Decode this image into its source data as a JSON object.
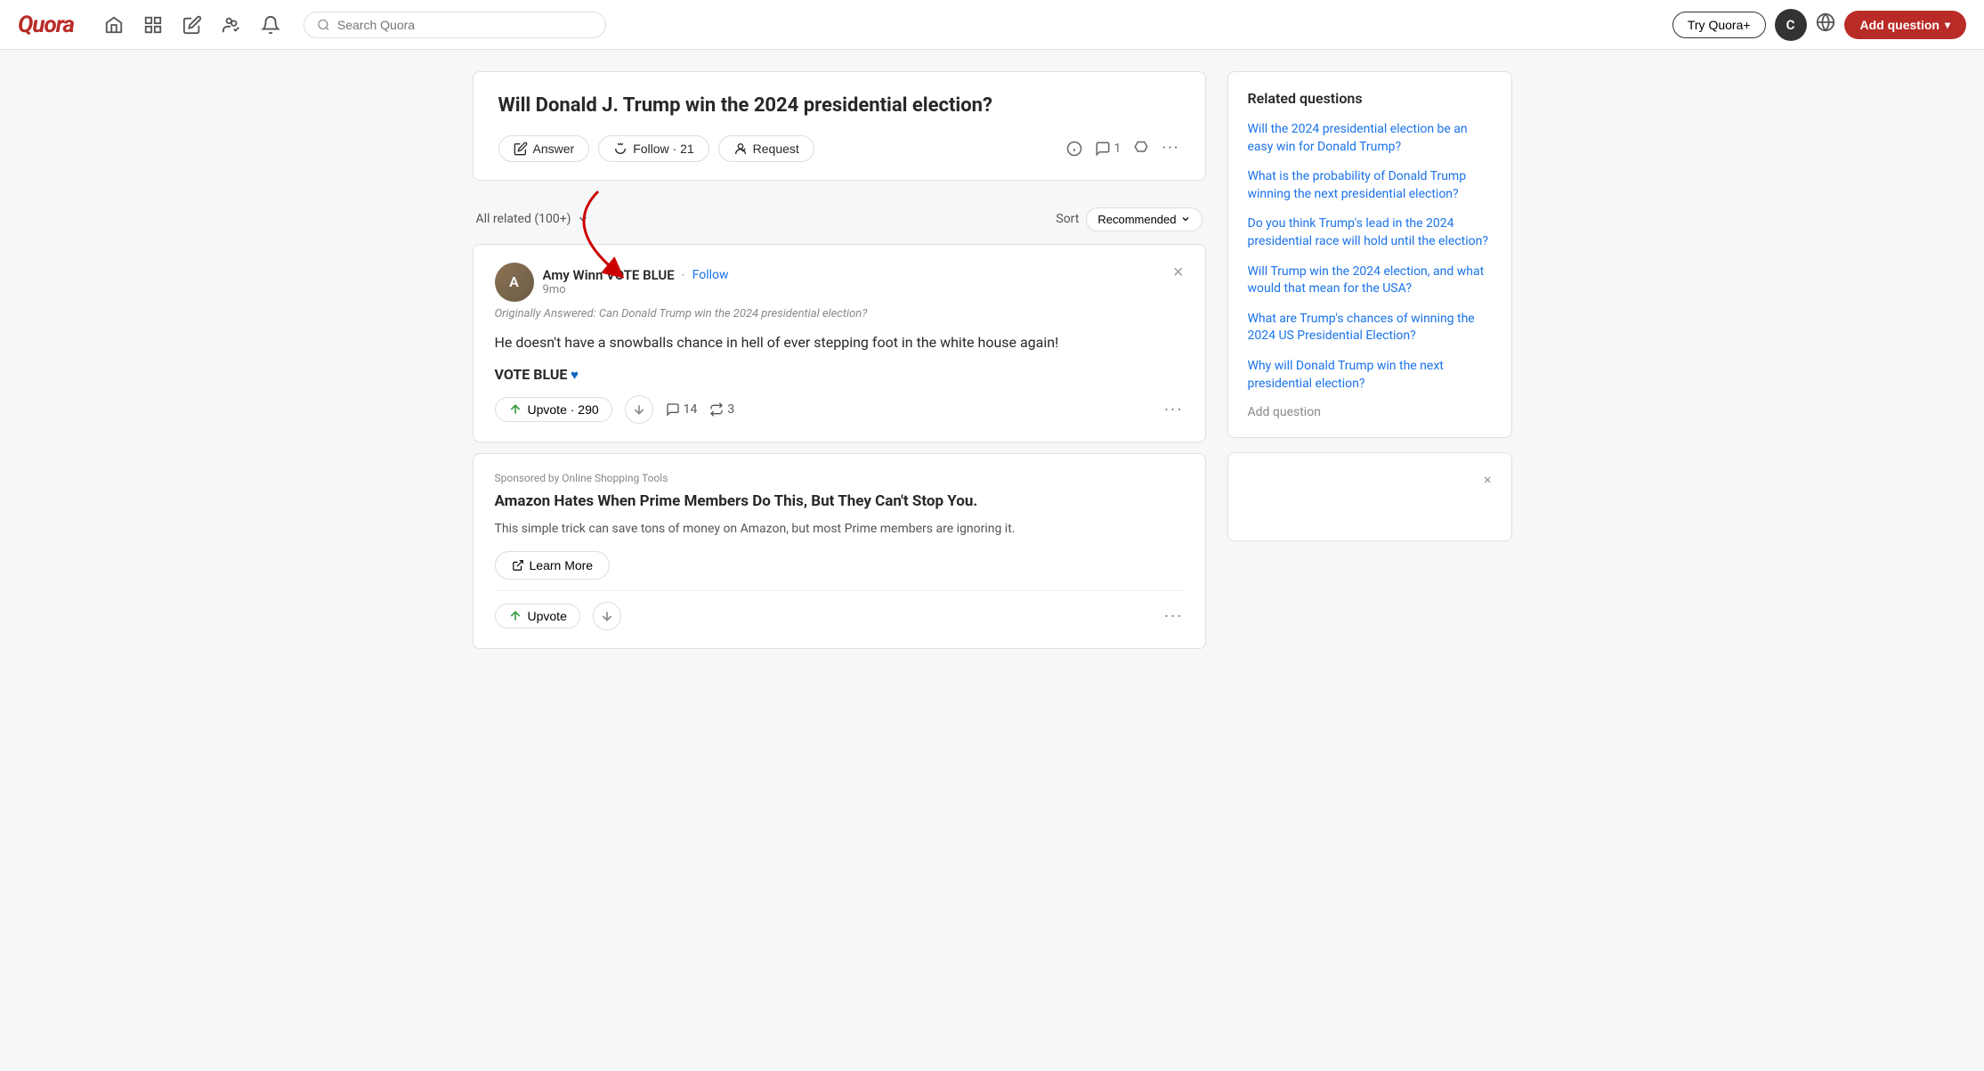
{
  "header": {
    "logo": "Quora",
    "search_placeholder": "Search Quora",
    "try_quora_label": "Try Quora+",
    "avatar_letter": "C",
    "add_question_label": "Add question"
  },
  "nav": {
    "icons": [
      "home",
      "feed",
      "edit",
      "spaces",
      "bell"
    ]
  },
  "question": {
    "title": "Will Donald J. Trump win the 2024 presidential election?",
    "answer_label": "Answer",
    "follow_label": "Follow · 21",
    "request_label": "Request",
    "comment_count": "1",
    "filter_label": "All related (100+)",
    "sort_label": "Sort",
    "recommended_label": "Recommended"
  },
  "answer": {
    "author_name": "Amy Winn VOTE BLUE",
    "follow_label": "Follow",
    "time": "9mo",
    "originally_answered": "Originally Answered: Can Donald Trump win the 2024 presidential election?",
    "text": "He doesn't have a snowballs chance in hell of ever stepping foot in the white house again!",
    "vote_blue": "VOTE BLUE",
    "upvote_label": "Upvote · 290",
    "comment_count": "14",
    "share_count": "3"
  },
  "ad": {
    "sponsor": "Sponsored by Online Shopping Tools",
    "title": "Amazon Hates When Prime Members Do This, But They Can't Stop You.",
    "description": "This simple trick can save tons of money on Amazon, but most Prime members are ignoring it.",
    "learn_more_label": "Learn More",
    "upvote_label": "Upvote"
  },
  "related_questions": {
    "title": "Related questions",
    "items": [
      "Will the 2024 presidential election be an easy win for Donald Trump?",
      "What is the probability of Donald Trump winning the next presidential election?",
      "Do you think Trump's lead in the 2024 presidential race will hold until the election?",
      "Will Trump win the 2024 election, and what would that mean for the USA?",
      "What are Trump's chances of winning the 2024 US Presidential Election?",
      "Why will Donald Trump win the next presidential election?"
    ],
    "add_question_label": "Add question"
  },
  "colors": {
    "brand_red": "#b92b27",
    "link_blue": "#1a73e8",
    "text_dark": "#282829",
    "text_muted": "#888888",
    "border": "#e0e0e0",
    "heart_blue": "#1565c0"
  }
}
